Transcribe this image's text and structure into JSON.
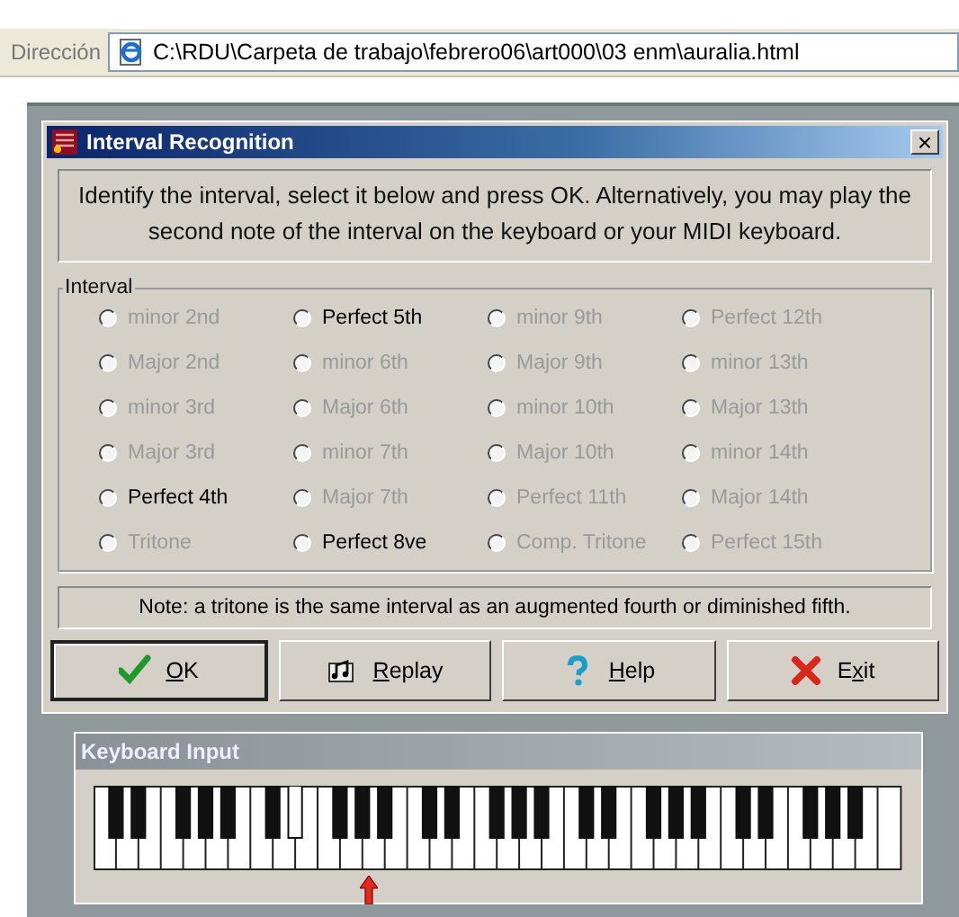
{
  "address_bar": {
    "label": "Dirección",
    "value": "C:\\RDU\\Carpeta de trabajo\\febrero06\\art000\\03 enm\\auralia.html"
  },
  "window": {
    "title": "Interval Recognition",
    "close": "×"
  },
  "instructions": "Identify the interval, select it below and press OK. Alternatively, you may play the second note of the interval on the keyboard or your MIDI keyboard.",
  "interval_group": {
    "title": "Interval",
    "options": [
      {
        "label": "minor 2nd",
        "disabled": true,
        "selected": false
      },
      {
        "label": "Perfect 5th",
        "disabled": false,
        "selected": false
      },
      {
        "label": "minor 9th",
        "disabled": true,
        "selected": false
      },
      {
        "label": "Perfect 12th",
        "disabled": true,
        "selected": false
      },
      {
        "label": "Major 2nd",
        "disabled": true,
        "selected": false
      },
      {
        "label": "minor 6th",
        "disabled": true,
        "selected": false
      },
      {
        "label": "Major 9th",
        "disabled": true,
        "selected": false
      },
      {
        "label": "minor 13th",
        "disabled": true,
        "selected": false
      },
      {
        "label": "minor 3rd",
        "disabled": true,
        "selected": false
      },
      {
        "label": "Major 6th",
        "disabled": true,
        "selected": false
      },
      {
        "label": "minor 10th",
        "disabled": true,
        "selected": false
      },
      {
        "label": "Major 13th",
        "disabled": true,
        "selected": false
      },
      {
        "label": "Major 3rd",
        "disabled": true,
        "selected": false
      },
      {
        "label": "minor 7th",
        "disabled": true,
        "selected": false
      },
      {
        "label": "Major 10th",
        "disabled": true,
        "selected": false
      },
      {
        "label": "minor 14th",
        "disabled": true,
        "selected": false
      },
      {
        "label": "Perfect 4th",
        "disabled": false,
        "selected": false
      },
      {
        "label": "Major 7th",
        "disabled": true,
        "selected": false
      },
      {
        "label": "Perfect 11th",
        "disabled": true,
        "selected": false
      },
      {
        "label": "Major 14th",
        "disabled": true,
        "selected": false
      },
      {
        "label": "Tritone",
        "disabled": true,
        "selected": false
      },
      {
        "label": "Perfect 8ve",
        "disabled": false,
        "selected": false
      },
      {
        "label": "Comp. Tritone",
        "disabled": true,
        "selected": false
      },
      {
        "label": "Perfect 15th",
        "disabled": true,
        "selected": false
      }
    ]
  },
  "note": "Note: a tritone is the same interval as an augmented fourth or diminished fifth.",
  "buttons": [
    {
      "kind": "ok",
      "key": "O",
      "after": "K",
      "default": true
    },
    {
      "kind": "replay",
      "key": "R",
      "after": "eplay",
      "default": false
    },
    {
      "kind": "help",
      "key": "H",
      "after": "elp",
      "default": false
    },
    {
      "kind": "exit",
      "before": "E",
      "key": "x",
      "after": "it",
      "default": false
    }
  ],
  "keyboard": {
    "title": "Keyboard Input"
  }
}
